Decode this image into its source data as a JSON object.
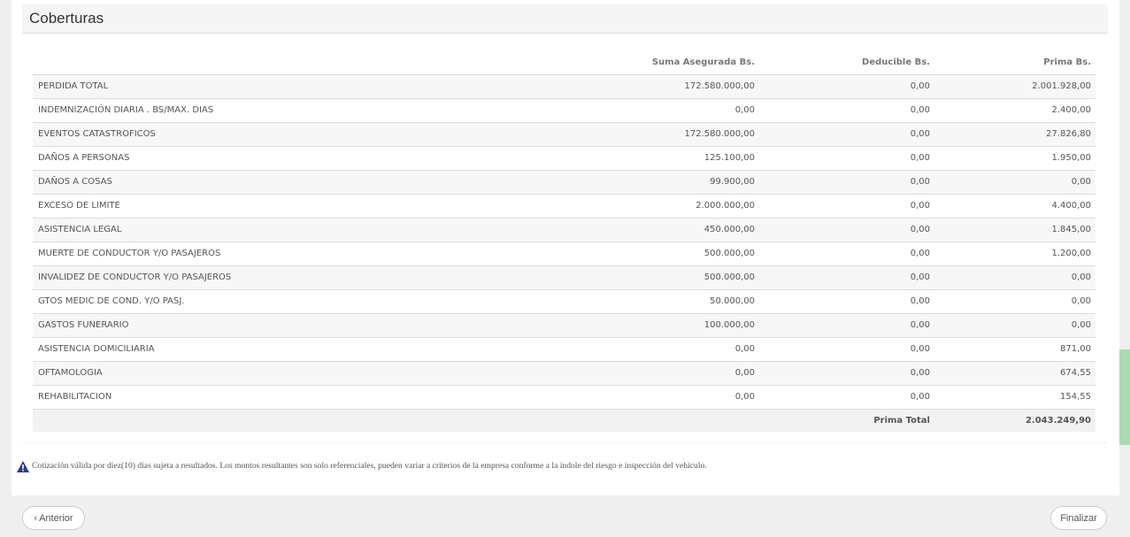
{
  "panel": {
    "title": "Coberturas"
  },
  "table": {
    "headers": {
      "name": "",
      "suma": "Suma Asegurada Bs.",
      "deducible": "Deducible Bs.",
      "prima": "Prima Bs."
    },
    "rows": [
      {
        "name": "PERDIDA TOTAL",
        "suma": "172.580.000,00",
        "deducible": "0,00",
        "prima": "2.001.928,00"
      },
      {
        "name": "INDEMNIZACIÓN DIARIA . BS/MAX. DIAS",
        "suma": "0,00",
        "deducible": "0,00",
        "prima": "2.400,00"
      },
      {
        "name": "EVENTOS CATASTROFICOS",
        "suma": "172.580.000,00",
        "deducible": "0,00",
        "prima": "27.826,80"
      },
      {
        "name": "DAÑOS A PERSONAS",
        "suma": "125.100,00",
        "deducible": "0,00",
        "prima": "1.950,00"
      },
      {
        "name": "DAÑOS A COSAS",
        "suma": "99.900,00",
        "deducible": "0,00",
        "prima": "0,00"
      },
      {
        "name": "EXCESO DE LIMITE",
        "suma": "2.000.000,00",
        "deducible": "0,00",
        "prima": "4.400,00"
      },
      {
        "name": "ASISTENCIA LEGAL",
        "suma": "450.000,00",
        "deducible": "0,00",
        "prima": "1.845,00"
      },
      {
        "name": "MUERTE DE CONDUCTOR Y/O PASAJEROS",
        "suma": "500.000,00",
        "deducible": "0,00",
        "prima": "1.200,00"
      },
      {
        "name": "INVALIDEZ DE CONDUCTOR Y/O PASAJEROS",
        "suma": "500.000,00",
        "deducible": "0,00",
        "prima": "0,00"
      },
      {
        "name": "GTOS MEDIC DE COND. Y/O PASJ.",
        "suma": "50.000,00",
        "deducible": "0,00",
        "prima": "0,00"
      },
      {
        "name": "GASTOS FUNERARIO",
        "suma": "100.000,00",
        "deducible": "0,00",
        "prima": "0,00"
      },
      {
        "name": "ASISTENCIA DOMICILIARIA",
        "suma": "0,00",
        "deducible": "0,00",
        "prima": "871,00"
      },
      {
        "name": "OFTAMOLOGIA",
        "suma": "0,00",
        "deducible": "0,00",
        "prima": "674,55"
      },
      {
        "name": "REHABILITACION",
        "suma": "0,00",
        "deducible": "0,00",
        "prima": "154,55"
      }
    ],
    "total_label": "Prima Total",
    "total_value": "2.043.249,90"
  },
  "notice": {
    "icon": "warning-icon",
    "text": "Cotización válida por diez(10) días sujeta a resultados. Los montos resultantes son solo referenciales, pueden variar a criterios de la empresa conforme a la índole del riesgo e inspección del vehículo."
  },
  "buttons": {
    "prev_chevron": "‹",
    "prev_label": "Anterior",
    "next_label": "Finalizar"
  },
  "colors": {
    "warning": "#2b3a8c",
    "scroll_indicator": "#a9dcb0"
  }
}
